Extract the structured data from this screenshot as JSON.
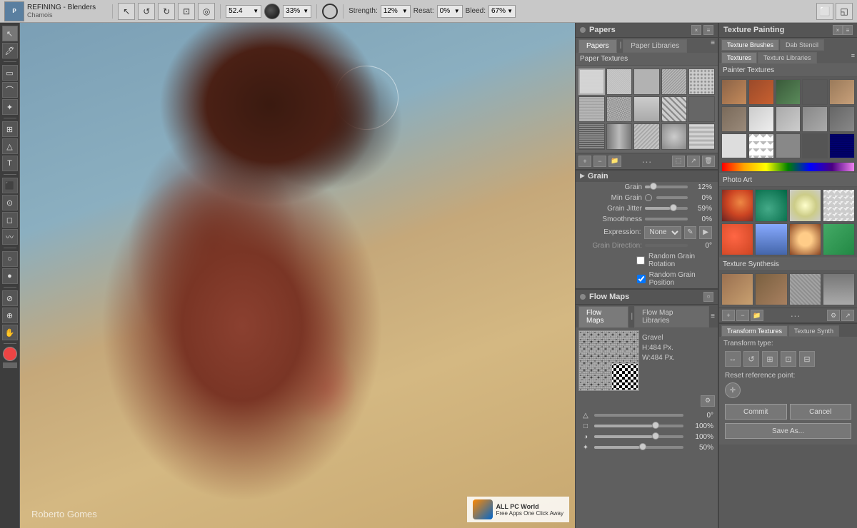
{
  "app": {
    "title": "REFINING - Blenders",
    "subtitle": "Chamois"
  },
  "toolbar": {
    "size_value": "52.4",
    "opacity_label": "33%",
    "strength_label": "Strength:",
    "strength_value": "12%",
    "resat_label": "Resat:",
    "resat_value": "0%",
    "bleed_label": "Bleed:",
    "bleed_value": "67%"
  },
  "papers": {
    "panel_title": "Papers",
    "tab_papers": "Papers",
    "tab_libraries": "Paper Libraries",
    "section_label": "Paper Textures",
    "thumbs": [
      1,
      2,
      3,
      4,
      5,
      6,
      7,
      8,
      9,
      10,
      11,
      12,
      13,
      14,
      15
    ]
  },
  "grain": {
    "panel_title": "Grain",
    "grain_label": "Grain",
    "grain_value": "12%",
    "min_grain_label": "Min Grain",
    "min_grain_value": "0%",
    "grain_jitter_label": "Grain Jitter",
    "grain_jitter_value": "59%",
    "smoothness_label": "Smoothness",
    "smoothness_value": "0%",
    "expression_label": "Expression:",
    "expression_value": "None",
    "grain_direction_label": "Grain Direction:",
    "grain_direction_value": "0°",
    "random_rotation_label": "Random Grain Rotation",
    "random_position_label": "Random Grain Position",
    "random_rotation_checked": false,
    "random_position_checked": true
  },
  "flowmaps": {
    "panel_title": "Flow Maps",
    "tab_flow_maps": "Flow Maps",
    "tab_libraries": "Flow Map Libraries",
    "thumb_name": "Gravel",
    "thumb_info_h": "H:484 Px.",
    "thumb_info_w": "W:484 Px.",
    "sliders": [
      {
        "icon": "△",
        "value": "0°",
        "fill_pct": 0
      },
      {
        "icon": "□",
        "value": "100%",
        "fill_pct": 65
      },
      {
        "icon": "◑",
        "value": "100%",
        "fill_pct": 65
      },
      {
        "icon": "✦",
        "value": "50%",
        "fill_pct": 50
      }
    ]
  },
  "texture_painting": {
    "panel_title": "Texture Painting",
    "tab_brushes": "Texture Brushes",
    "tab_dab": "Dab Stencil",
    "tab_textures": "Textures",
    "tab_libraries": "Texture Libraries",
    "section_painter": "Painter Textures",
    "section_photo_art": "Photo Art",
    "section_synth": "Texture Synthesis"
  },
  "transform": {
    "tab_transform": "Transform Textures",
    "tab_synth": "Texture Synth",
    "type_label": "Transform type:",
    "reset_label": "Reset reference point:",
    "commit_label": "Commit",
    "cancel_label": "Cancel",
    "save_as_label": "Save As..."
  },
  "canvas": {
    "credit": "Roberto Gomes",
    "watermark_line1": "ALL PC World",
    "watermark_line2": "Free Apps One Click Away"
  }
}
